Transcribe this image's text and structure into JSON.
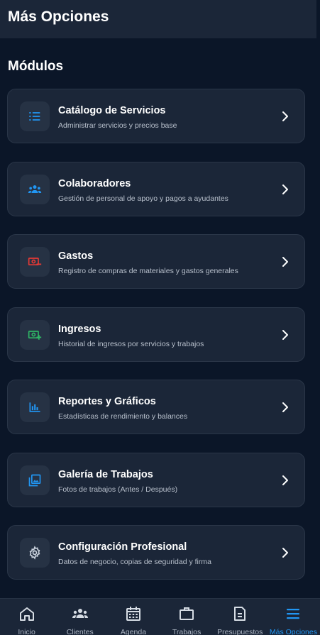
{
  "header": {
    "title": "Más Opciones"
  },
  "section": {
    "title": "Módulos"
  },
  "modules": [
    {
      "title": "Catálogo de Servicios",
      "subtitle": "Administrar servicios y precios base",
      "icon": "list-icon",
      "color": "#2196f3"
    },
    {
      "title": "Colaboradores",
      "subtitle": "Gestión de personal de apoyo y pagos a ayudantes",
      "icon": "people-icon",
      "color": "#2196f3"
    },
    {
      "title": "Gastos",
      "subtitle": "Registro de compras de materiales y gastos generales",
      "icon": "money-out-icon",
      "color": "#e53935"
    },
    {
      "title": "Ingresos",
      "subtitle": "Historial de ingresos por servicios y trabajos",
      "icon": "money-in-icon",
      "color": "#2fb565"
    },
    {
      "title": "Reportes y Gráficos",
      "subtitle": "Estadísticas de rendimiento y balances",
      "icon": "bar-chart-icon",
      "color": "#2196f3"
    },
    {
      "title": "Galería de Trabajos",
      "subtitle": "Fotos de trabajos (Antes / Después)",
      "icon": "gallery-icon",
      "color": "#2196f3"
    },
    {
      "title": "Configuración Profesional",
      "subtitle": "Datos de negocio, copias de seguridad y firma",
      "icon": "gear-icon",
      "color": "#c9d1dc"
    }
  ],
  "nav": [
    {
      "label": "Inicio",
      "icon": "home-icon",
      "active": false
    },
    {
      "label": "Clientes",
      "icon": "people-icon",
      "active": false
    },
    {
      "label": "Agenda",
      "icon": "calendar-icon",
      "active": false
    },
    {
      "label": "Trabajos",
      "icon": "briefcase-icon",
      "active": false
    },
    {
      "label": "Presupuestos",
      "icon": "document-icon",
      "active": false
    },
    {
      "label": "Más Opciones",
      "icon": "menu-icon",
      "active": true
    }
  ],
  "colors": {
    "background": "#0b1628",
    "surface": "#1b2638",
    "accent": "#2196f3"
  }
}
